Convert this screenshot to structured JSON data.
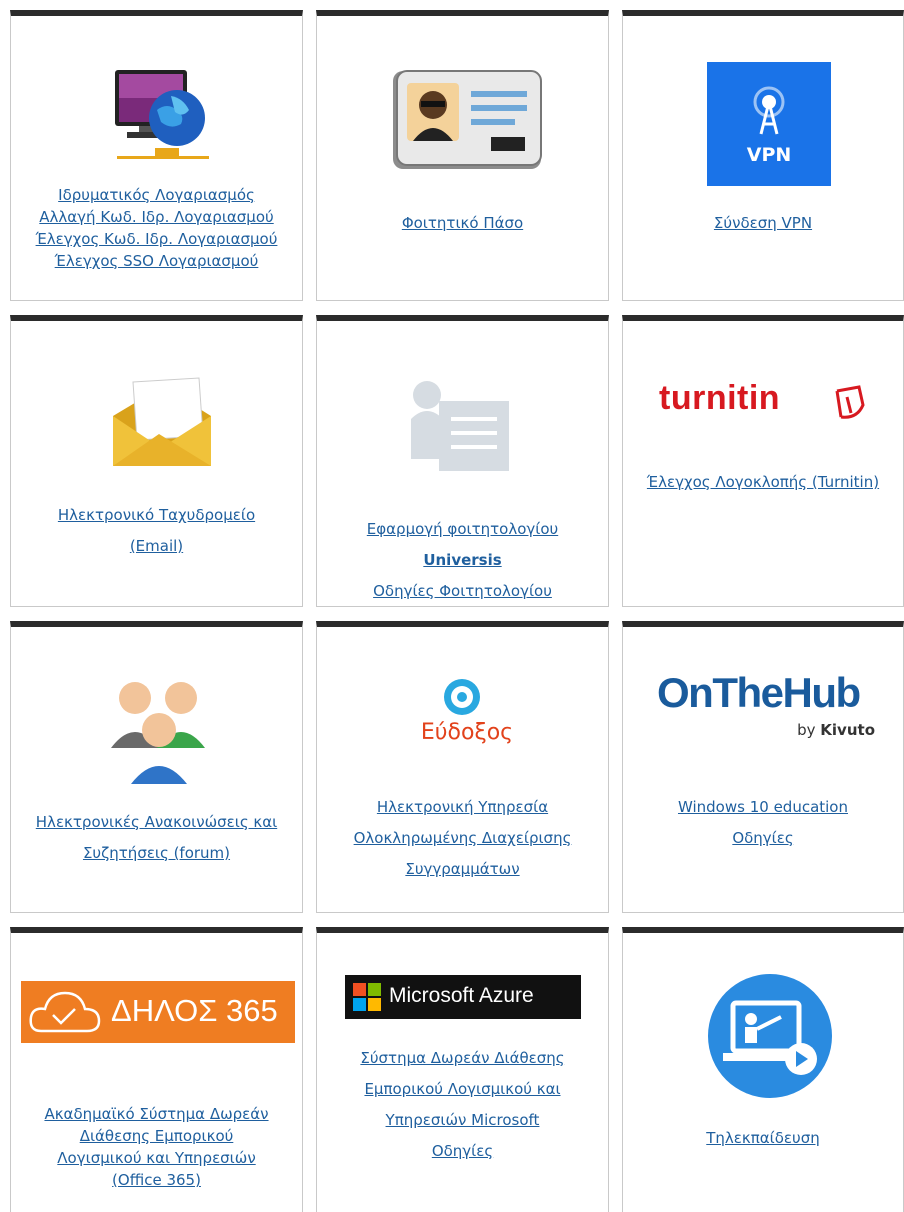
{
  "cards": [
    {
      "links": [
        "Ιδρυματικός Λογαριασμός",
        "Αλλαγή Κωδ. Ιδρ. Λογαριασμού",
        "Έλεγχος Κωδ. Ιδρ. Λογαριασμού",
        "Έλεγχος SSO Λογαριασμού"
      ]
    },
    {
      "links": [
        "Φοιτητικό Πάσο"
      ]
    },
    {
      "links": [
        "Σύνδεση VPN"
      ],
      "logo_text": "VPN"
    },
    {
      "links": [
        "Ηλεκτρονικό Ταχυδρομείο",
        "(Email)"
      ]
    },
    {
      "links": [
        "Εφαρμογή φοιτητολογίου",
        "Universis",
        "Οδηγίες Φοιτητολογίου"
      ]
    },
    {
      "links": [
        "Έλεγχος Λογοκλοπής (Turnitin)"
      ],
      "logo_text": "turnitin"
    },
    {
      "links": [
        "Ηλεκτρονικές Ανακοινώσεις και",
        "Συζητήσεις (forum)"
      ]
    },
    {
      "links": [
        "Ηλεκτρονική Υπηρεσία",
        "Ολοκληρωμένης Διαχείρισης",
        "Συγγραμμάτων"
      ],
      "logo_text": "Εύδοξος"
    },
    {
      "links": [
        "Windows 10 education",
        "Οδηγίες"
      ],
      "logo_text": "OnTheHub",
      "logo_sub_by": "by",
      "logo_sub": "Kivuto"
    },
    {
      "links": [
        "Ακαδημαϊκό Σύστημα Δωρεάν",
        "Διάθεσης Εμπορικού",
        "Λογισμικού και Υπηρεσιών",
        "(Office 365)"
      ],
      "logo_text": "ΔΗΛΟΣ 365"
    },
    {
      "links": [
        "Σύστημα Δωρεάν Διάθεσης",
        "Εμπορικού Λογισμικού και",
        "Υπηρεσιών Microsoft",
        "Οδηγίες"
      ],
      "logo_text": "Microsoft Azure"
    },
    {
      "links": [
        "Τηλεκπαίδευση"
      ]
    }
  ],
  "colors": {
    "link": "#1f5f9e",
    "card_top": "#2b2b2b",
    "vpn": "#1a73e8",
    "turnitin": "#d71920",
    "delos": "#ef7d22",
    "onthehub": "#1a5b9c"
  }
}
